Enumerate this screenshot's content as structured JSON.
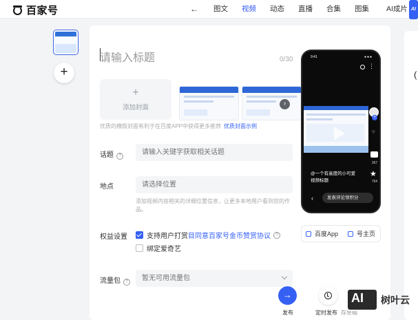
{
  "header": {
    "logo_text": "百家号",
    "nav": [
      "图文",
      "视频",
      "动态",
      "直播",
      "合集",
      "图集"
    ],
    "active_nav": "视频",
    "ai_label": "AI成片",
    "ai_badge": "AI"
  },
  "form": {
    "title_placeholder": "请输入标题",
    "title_count": "0/30",
    "cover_add_label": "添加封面",
    "cover_hint": "优质的横版封面有利于在百度APP中获得更多推荐",
    "cover_example_link": "优质封面示例",
    "topic_label": "话题",
    "topic_placeholder": "请输入关键字获取相关话题",
    "location_label": "地点",
    "location_placeholder": "请选择位置",
    "location_hint": "添加视频内容相关的详细位置信息，让更多本地用户看到您的作品。",
    "rights_label": "权益设置",
    "reward_text": "支持用户打赏",
    "reward_link": "目同意百家号金币赞赏协议",
    "reward_checked": true,
    "iqiyi_text": "绑定爱奇艺",
    "iqiyi_checked": false,
    "traffic_label": "流量包",
    "traffic_placeholder": "暂无可用流量包"
  },
  "preview": {
    "time": "9:41",
    "caption": "@一个有高度的小可爱 视频标题",
    "count_comment": "367",
    "count_star": "764",
    "comment_prompt": "发表评论领积分",
    "tab_app": "百度App",
    "tab_home": "号主页"
  },
  "actions": {
    "publish": "发布",
    "timed_publish": "定时发布",
    "save_draft": "存草稿"
  },
  "watermark": {
    "logo": "AI",
    "text": "树叶云"
  },
  "colors": {
    "accent": "#3560f4"
  }
}
